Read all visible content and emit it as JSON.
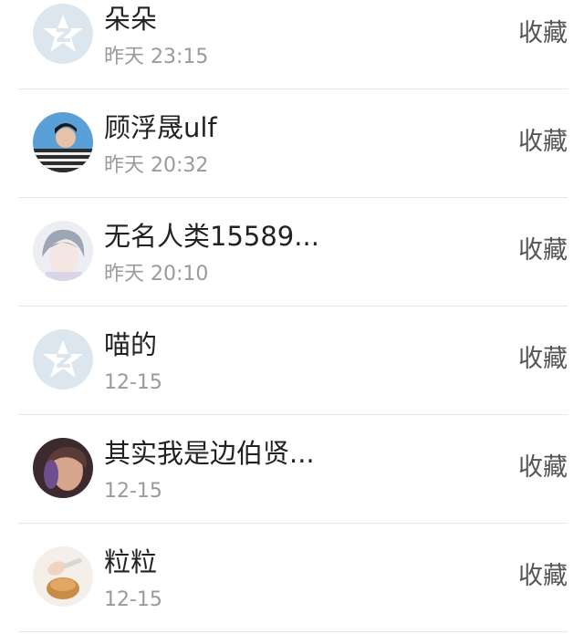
{
  "contacts": [
    {
      "name": "朵朵",
      "time": "昨天 23:15",
      "action": "收藏",
      "avatar": "qq-default-avatar"
    },
    {
      "name": "顾浮晟ulf",
      "time": "昨天 20:32",
      "action": "收藏",
      "avatar": "user-photo-avatar"
    },
    {
      "name": "无名人类15589...",
      "time": "昨天 20:10",
      "action": "收藏",
      "avatar": "anime-avatar"
    },
    {
      "name": "喵的",
      "time": "12-15",
      "action": "收藏",
      "avatar": "qq-default-avatar"
    },
    {
      "name": "其实我是边伯贤...",
      "time": "12-15",
      "action": "收藏",
      "avatar": "user-photo-avatar"
    },
    {
      "name": "粒粒",
      "time": "12-15",
      "action": "收藏",
      "avatar": "food-photo-avatar"
    }
  ]
}
